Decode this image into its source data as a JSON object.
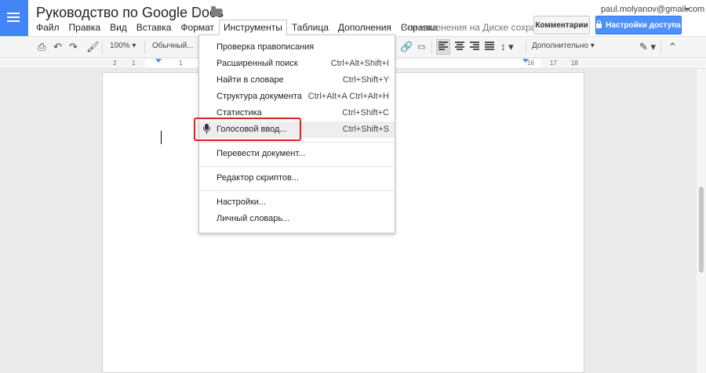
{
  "document": {
    "title": "Руководство по Google Docs"
  },
  "menubar": [
    "Файл",
    "Правка",
    "Вид",
    "Вставка",
    "Формат",
    "Инструменты",
    "Таблица",
    "Дополнения",
    "Справка"
  ],
  "save_status": "Все изменения на Диске сохран...",
  "user": {
    "email": "paul.molyanov@gmail.com"
  },
  "buttons": {
    "comments": "Комментарии",
    "share": "Настройки доступа"
  },
  "toolbar": {
    "zoom": "100%",
    "style": "Обычный...",
    "more": "Дополнительно"
  },
  "ruler": [
    "2",
    "1",
    "1",
    "16",
    "17",
    "18"
  ],
  "tools_menu": {
    "items": [
      {
        "label": "Проверка правописания",
        "shortcut": ""
      },
      {
        "label": "Расширенный поиск",
        "shortcut": "Ctrl+Alt+Shift+I"
      },
      {
        "label": "Найти в словаре",
        "shortcut": "Ctrl+Shift+Y"
      },
      {
        "label": "Структура документа",
        "shortcut": "Ctrl+Alt+A Ctrl+Alt+H"
      },
      {
        "label": "Статистика",
        "shortcut": "Ctrl+Shift+C"
      },
      {
        "label": "Голосовой ввод...",
        "shortcut": "Ctrl+Shift+S",
        "icon": "mic-icon",
        "highlighted": true
      },
      {
        "label": "Перевести документ...",
        "shortcut": ""
      },
      {
        "label": "Редактор скриптов...",
        "shortcut": ""
      },
      {
        "label": "Настройки...",
        "shortcut": ""
      },
      {
        "label": "Личный словарь...",
        "shortcut": ""
      }
    ]
  },
  "colors": {
    "brand": "#4285f4",
    "share_button": "#4d90fe",
    "highlight_box": "#e02121"
  }
}
